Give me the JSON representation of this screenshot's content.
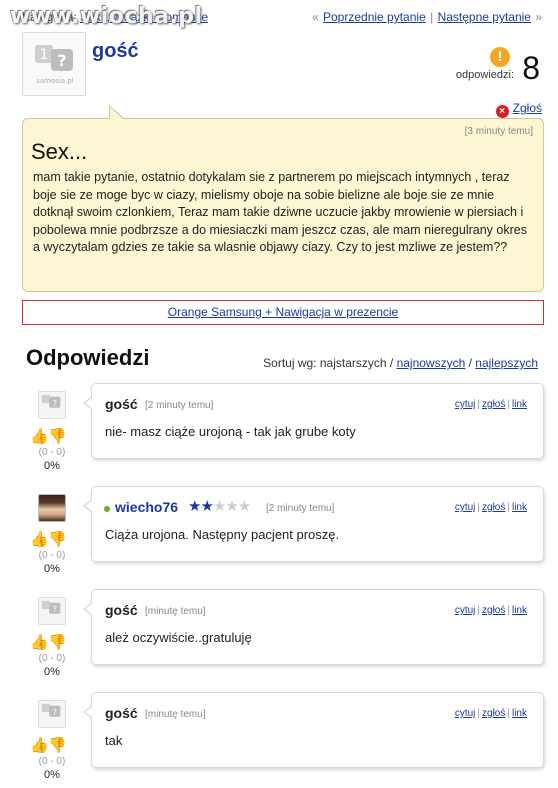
{
  "topbar": {
    "category_label": "Kategoria:",
    "category_link": "Seks, związki i romanse",
    "watermark": "www.wiocha.pl",
    "nav_prev": "Poprzednie pytanie",
    "nav_next": "Następne pytanie",
    "nav_open": "«",
    "nav_sep": "|",
    "nav_close": "»"
  },
  "question": {
    "avatar_text": "samosia.pl",
    "author": "gość",
    "answers_label": "odpowiedzi:",
    "answers_count": "8",
    "report_label": "Zgłoś",
    "time": "[3 minuty temu]",
    "title": "Sex...",
    "body": "mam takie pytanie, ostatnio dotykalam sie z partnerem po miejscach intymnych , teraz boje sie ze moge byc w ciazy, mielismy oboje na sobie bielizne ale boje sie ze mnie dotknął swoim czlonkiem, Teraz mam takie dziwne uczucie jakby mrowienie w piersiach i pobolewa mnie podbrzsze a do miesiaczki mam jeszcz czas, ale mam nieregulrany okres a wyczytalam gdzies ze takie sa wlasnie objawy ciazy. Czy to jest mzliwe ze jestem??"
  },
  "ad": {
    "text": "Orange Samsung + Nawigacja w prezencie"
  },
  "answers_section": {
    "title": "Odpowiedzi",
    "sort_label": "Sortuj wg: najstarszych /",
    "sort_newest": "najnowszych",
    "sort_sep": "/",
    "sort_best": "najlepszych"
  },
  "answer_links": {
    "quote": "cytuj",
    "report": "zgłoś",
    "link": "link"
  },
  "answers": [
    {
      "author": "gość",
      "time": "[2 minuty temu]",
      "text": "nie- masz ciąże urojoną - tak jak grube koty",
      "votes": "(0 - 0)",
      "percent": "0%"
    },
    {
      "author": "wiecho76",
      "time": "[2 minuty temu]",
      "text": "Ciąża urojona. Następny pacjent proszę.",
      "votes": "(0 - 0)",
      "percent": "0%",
      "rating": 2,
      "rating_max": 5
    },
    {
      "author": "gość",
      "time": "[minutę temu]",
      "text": "ależ oczywiście..gratuluję",
      "votes": "(0 - 0)",
      "percent": "0%"
    },
    {
      "author": "gość",
      "time": "[minutę temu]",
      "text": "tak",
      "votes": "(0 - 0)",
      "percent": "0%"
    }
  ],
  "icons": {
    "vote_up": "thumb-up-icon",
    "vote_down": "thumb-down-icon",
    "warning": "exclamation-icon",
    "report": "close-circle-icon"
  },
  "colors": {
    "link": "#1a3aa0",
    "question_bg": "#fdf6d3",
    "ad_border": "#c8323a",
    "online": "#66b032"
  }
}
